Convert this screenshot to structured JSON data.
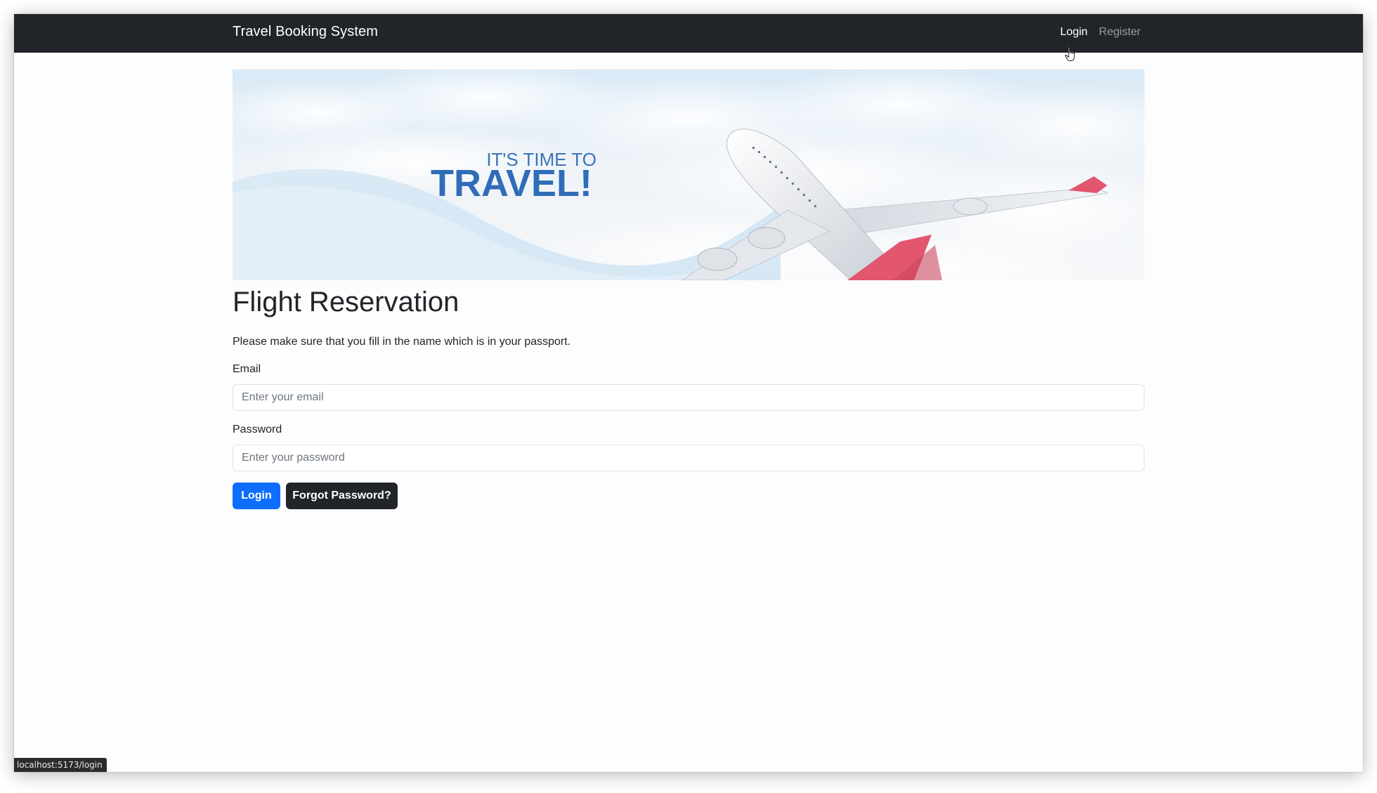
{
  "navbar": {
    "brand": "Travel Booking System",
    "links": [
      {
        "label": "Login",
        "active": true
      },
      {
        "label": "Register",
        "active": false
      }
    ]
  },
  "banner": {
    "tagline": "IT'S TIME TO",
    "headline": "TRAVEL!"
  },
  "page": {
    "title": "Flight Reservation",
    "intro": "Please make sure that you fill in the name which is in your passport."
  },
  "form": {
    "email_label": "Email",
    "email_placeholder": "Enter your email",
    "email_value": "",
    "password_label": "Password",
    "password_placeholder": "Enter your password",
    "password_value": "",
    "login_button": "Login",
    "forgot_button": "Forgot Password?"
  },
  "status_bar": {
    "url": "localhost:5173/login"
  },
  "colors": {
    "navbar_bg": "#212529",
    "primary": "#0d6efd",
    "dark_button": "#212529",
    "headline_blue": "#2f6db8",
    "plane_tail": "#e2566f"
  },
  "icons": [
    "hand-pointer-cursor-icon"
  ]
}
